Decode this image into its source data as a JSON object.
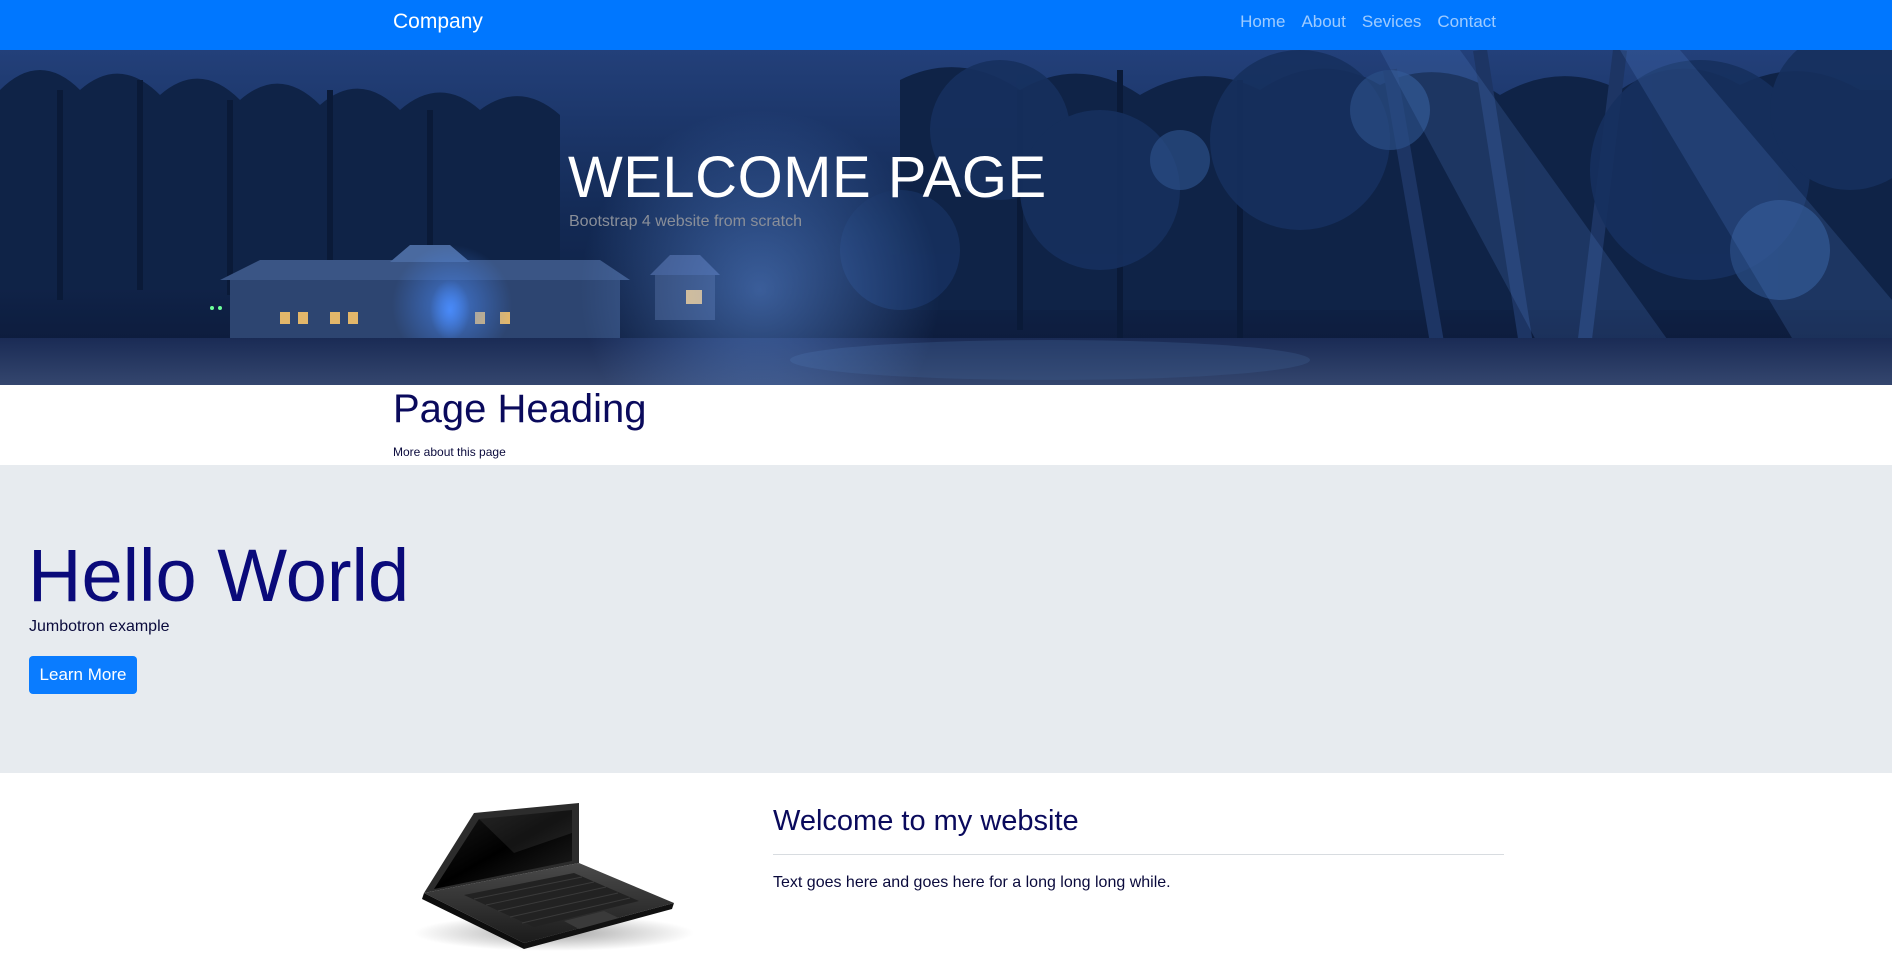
{
  "navbar": {
    "brand": "Company",
    "items": [
      {
        "label": "Home"
      },
      {
        "label": "About"
      },
      {
        "label": "Sevices"
      },
      {
        "label": "Contact"
      }
    ],
    "background_color": "#0077ff"
  },
  "hero": {
    "title": "WELCOME PAGE",
    "subtitle": "Bootstrap 4 website from scratch"
  },
  "page_heading": {
    "title": "Page Heading",
    "subtitle": "More about this page"
  },
  "jumbotron": {
    "title": "Hello World",
    "lead": "Jumbotron example",
    "button_label": "Learn More",
    "background_color": "#e7ebef"
  },
  "welcome": {
    "title": "Welcome to my website",
    "text": "Text goes here and goes here for a long long long while."
  }
}
